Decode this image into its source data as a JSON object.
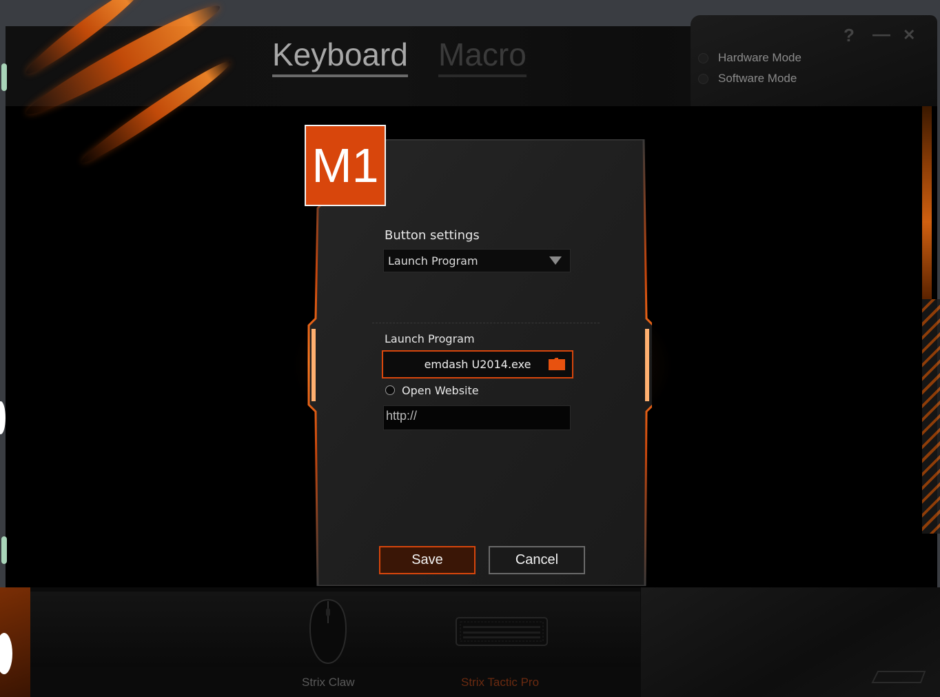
{
  "header": {
    "tab_keyboard": "Keyboard",
    "tab_macro": "Macro",
    "help_symbol": "?",
    "minimize_symbol": "—",
    "close_symbol": "✕"
  },
  "modes": [
    {
      "label": "Hardware Mode"
    },
    {
      "label": "Software Mode"
    }
  ],
  "dialog": {
    "key_badge": "M1",
    "button_settings_label": "Button settings",
    "action_select_value": "Launch Program",
    "launch_program_label": "Launch Program",
    "program_value": "emdash U2014.exe",
    "open_website_label": "Open Website",
    "url_value": "http://",
    "save_label": "Save",
    "cancel_label": "Cancel"
  },
  "devices": [
    {
      "label": "Strix Claw",
      "color": "#5a5a5a"
    },
    {
      "label": "Strix Tactic Pro",
      "color": "#6a2a10"
    }
  ],
  "colors": {
    "accent": "#d8460c",
    "background": "#000000"
  }
}
